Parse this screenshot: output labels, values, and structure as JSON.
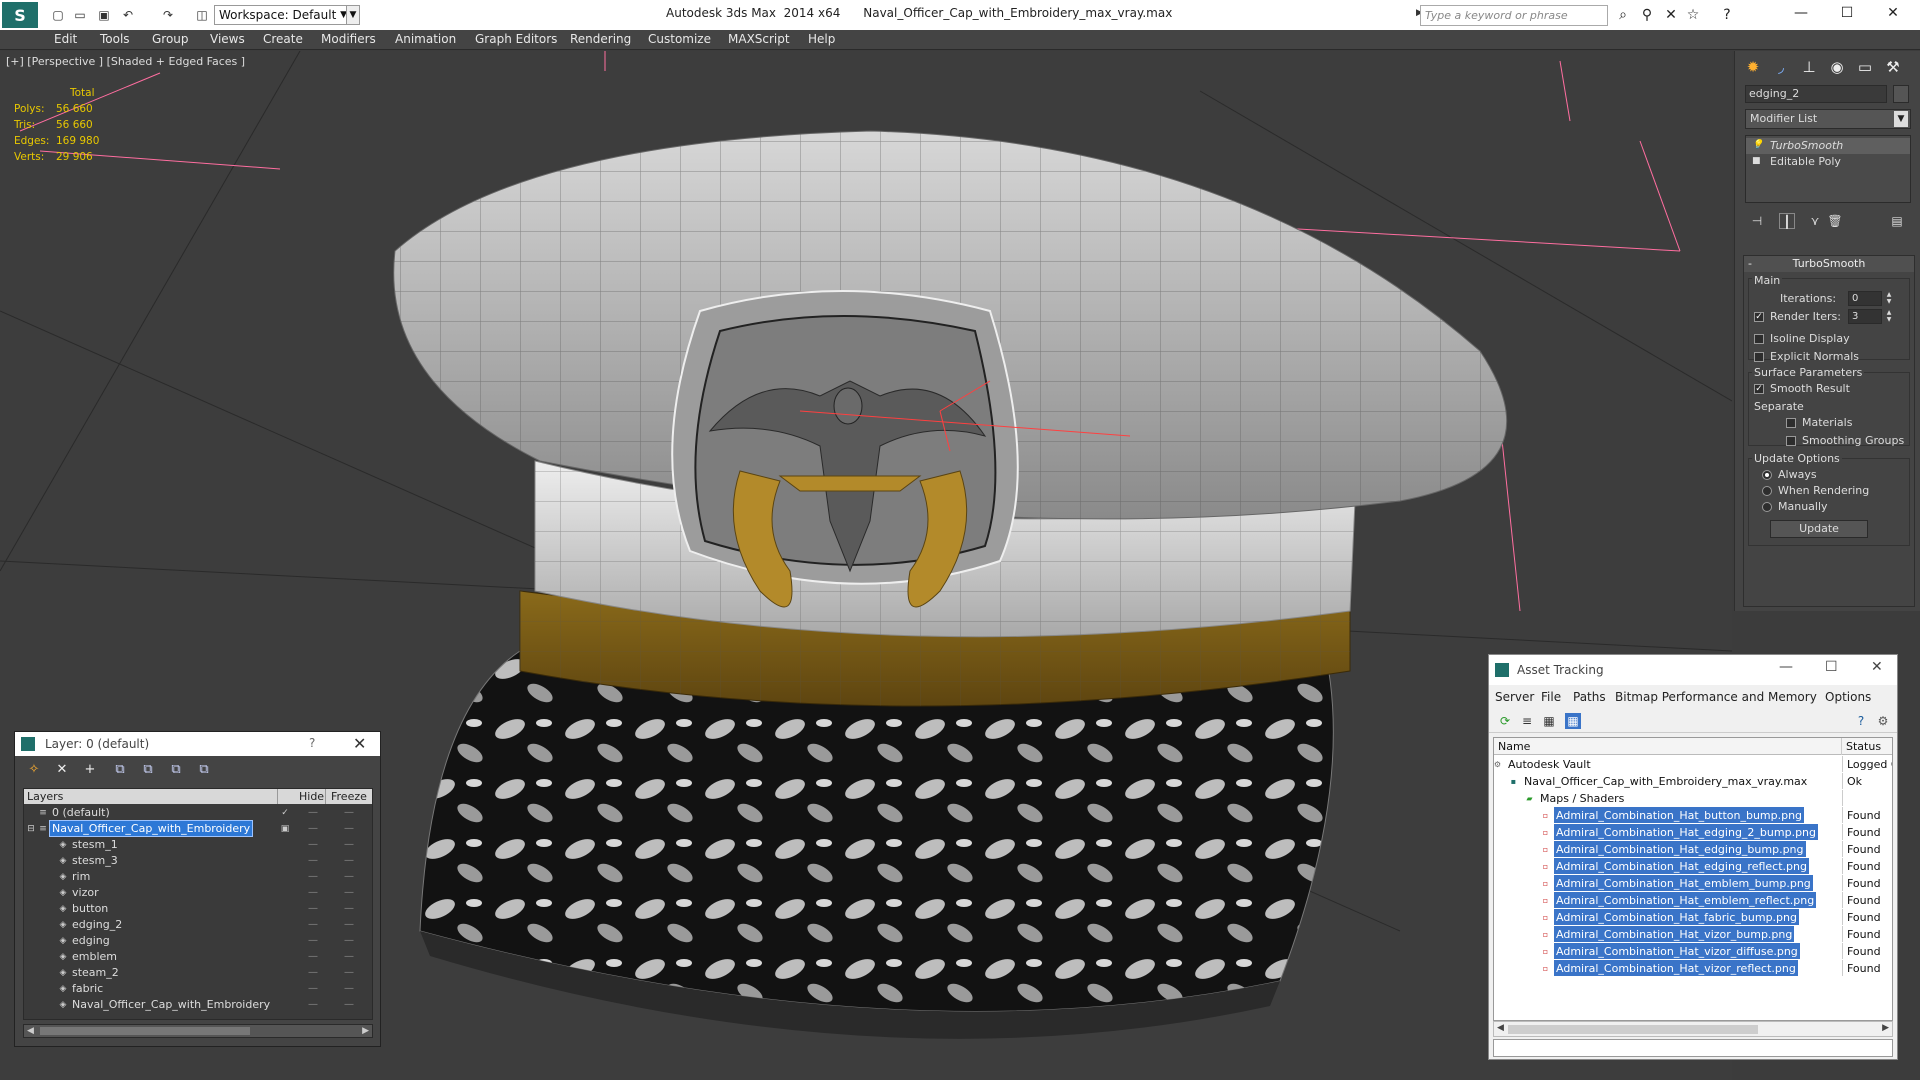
{
  "titlebar": {
    "workspace": "Workspace: Default",
    "app_name": "Autodesk 3ds Max  2014 x64",
    "file_name": "Naval_Officer_Cap_with_Embroidery_max_vray.max",
    "search_placeholder": "Type a keyword or phrase"
  },
  "menu": [
    "Edit",
    "Tools",
    "Group",
    "Views",
    "Create",
    "Modifiers",
    "Animation",
    "Graph Editors",
    "Rendering",
    "Customize",
    "MAXScript",
    "Help"
  ],
  "viewport": {
    "label": "[+] [Perspective ] [Shaded + Edged Faces ]",
    "stats_header": "Total",
    "stats": [
      {
        "key": "Polys:",
        "value": "56 660"
      },
      {
        "key": "Tris:",
        "value": "56 660"
      },
      {
        "key": "Edges:",
        "value": "169 980"
      },
      {
        "key": "Verts:",
        "value": "29 906"
      }
    ]
  },
  "command_panel": {
    "object_name": "edging_2",
    "modifier_list": "Modifier List",
    "stack": [
      "TurboSmooth",
      "Editable Poly"
    ],
    "rollout_title": "TurboSmooth",
    "main_label": "Main",
    "iterations_label": "Iterations:",
    "iterations_value": "0",
    "render_iters_label": "Render Iters:",
    "render_iters_value": "3",
    "isoline_label": "Isoline Display",
    "explicit_normals_label": "Explicit Normals",
    "surface_params_label": "Surface Parameters",
    "smooth_result_label": "Smooth Result",
    "separate_label": "Separate",
    "materials_label": "Materials",
    "smoothing_groups_label": "Smoothing Groups",
    "update_options_label": "Update Options",
    "always_label": "Always",
    "when_rendering_label": "When Rendering",
    "manually_label": "Manually",
    "update_button": "Update"
  },
  "layer_dialog": {
    "title": "Layer: 0 (default)",
    "help": "?",
    "columns": [
      "Layers",
      "Hide",
      "Freeze"
    ],
    "rows": [
      {
        "name": "0 (default)",
        "indent": 0
      },
      {
        "name": "Naval_Officer_Cap_with_Embroidery",
        "indent": 0
      },
      {
        "name": "stesm_1",
        "indent": 1
      },
      {
        "name": "stesm_3",
        "indent": 1
      },
      {
        "name": "rim",
        "indent": 1
      },
      {
        "name": "vizor",
        "indent": 1
      },
      {
        "name": "button",
        "indent": 1
      },
      {
        "name": "edging_2",
        "indent": 1
      },
      {
        "name": "edging",
        "indent": 1
      },
      {
        "name": "emblem",
        "indent": 1
      },
      {
        "name": "steam_2",
        "indent": 1
      },
      {
        "name": "fabric",
        "indent": 1
      },
      {
        "name": "Naval_Officer_Cap_with_Embroidery",
        "indent": 1
      }
    ]
  },
  "asset_tracking": {
    "title": "Asset Tracking",
    "menu": [
      "Server",
      "File",
      "Paths",
      "Bitmap Performance and Memory",
      "Options"
    ],
    "columns": [
      "Name",
      "Status"
    ],
    "rows": [
      {
        "name": "Autodesk Vault",
        "status": "Logged O",
        "level": 0
      },
      {
        "name": "Naval_Officer_Cap_with_Embroidery_max_vray.max",
        "status": "Ok",
        "level": 1
      },
      {
        "name": "Maps / Shaders",
        "status": "",
        "level": 2
      },
      {
        "name": "Admiral_Combination_Hat_button_bump.png",
        "status": "Found",
        "level": 3
      },
      {
        "name": "Admiral_Combination_Hat_edging_2_bump.png",
        "status": "Found",
        "level": 3
      },
      {
        "name": "Admiral_Combination_Hat_edging_bump.png",
        "status": "Found",
        "level": 3
      },
      {
        "name": "Admiral_Combination_Hat_edging_reflect.png",
        "status": "Found",
        "level": 3
      },
      {
        "name": "Admiral_Combination_Hat_emblem_bump.png",
        "status": "Found",
        "level": 3
      },
      {
        "name": "Admiral_Combination_Hat_emblem_reflect.png",
        "status": "Found",
        "level": 3
      },
      {
        "name": "Admiral_Combination_Hat_fabric_bump.png",
        "status": "Found",
        "level": 3
      },
      {
        "name": "Admiral_Combination_Hat_vizor_bump.png",
        "status": "Found",
        "level": 3
      },
      {
        "name": "Admiral_Combination_Hat_vizor_diffuse.png",
        "status": "Found",
        "level": 3
      },
      {
        "name": "Admiral_Combination_Hat_vizor_reflect.png",
        "status": "Found",
        "level": 3
      }
    ]
  },
  "colors": {
    "stats": "#e8c800",
    "selection": "#2d78d6",
    "brand": "#1f6f6a"
  }
}
